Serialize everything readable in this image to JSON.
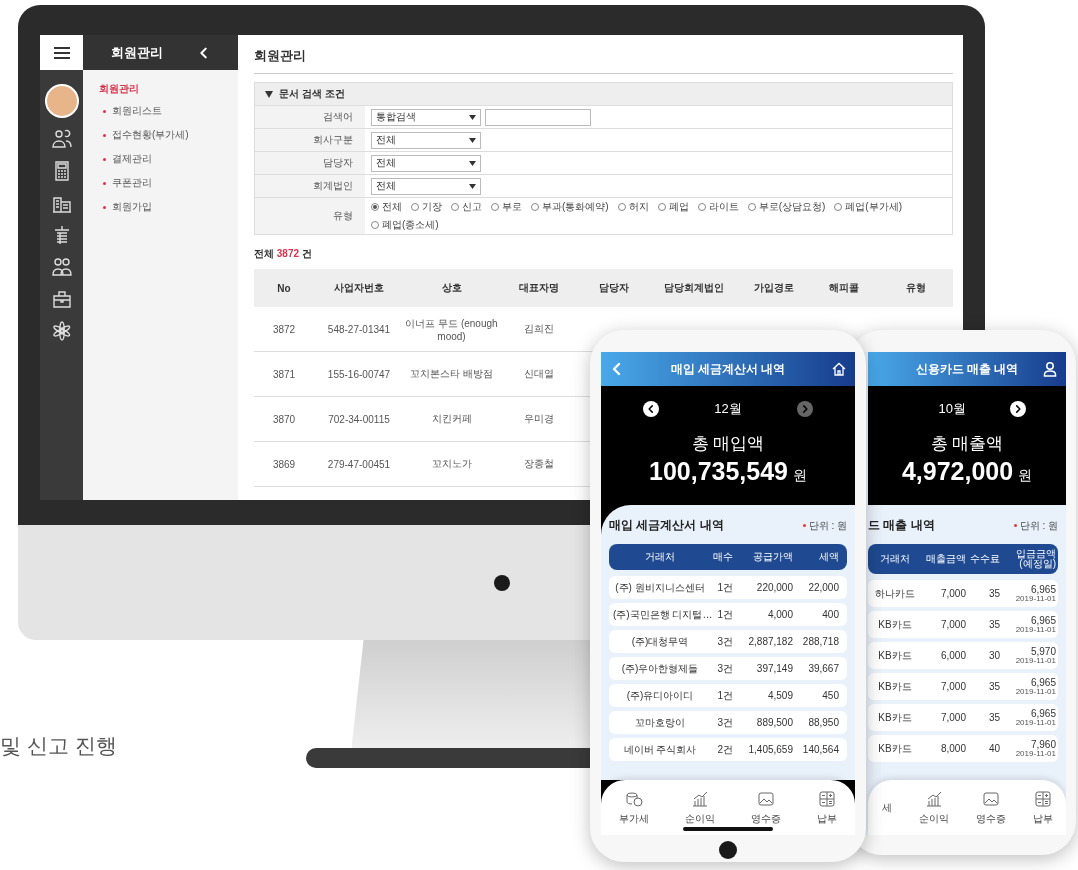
{
  "monitor": {
    "sidebar": {
      "title": "회원관리",
      "section": "회원관리",
      "items": [
        "회원리스트",
        "접수현황(부가세)",
        "결제관리",
        "쿠폰관리",
        "회원가입"
      ]
    },
    "page_title": "회원관리",
    "filter": {
      "title": "문서 검색 조건",
      "fields": [
        {
          "label": "검색어",
          "kind": "select_input",
          "value": "통합검색"
        },
        {
          "label": "회사구분",
          "kind": "select",
          "value": "전체"
        },
        {
          "label": "담당자",
          "kind": "select",
          "value": "전체"
        },
        {
          "label": "회계법인",
          "kind": "select",
          "value": "전체"
        }
      ],
      "type_label": "유형",
      "options": [
        {
          "label": "전체",
          "selected": true
        },
        {
          "label": "기장",
          "selected": false
        },
        {
          "label": "신고",
          "selected": false
        },
        {
          "label": "부로",
          "selected": false
        },
        {
          "label": "부과(통화예약)",
          "selected": false
        },
        {
          "label": "허지",
          "selected": false
        },
        {
          "label": "폐업",
          "selected": false
        },
        {
          "label": "라이트",
          "selected": false
        },
        {
          "label": "부로(상담요청)",
          "selected": false
        },
        {
          "label": "폐업(부가세)",
          "selected": false
        },
        {
          "label": "폐업(종소세)",
          "selected": false
        }
      ]
    },
    "count": {
      "prefix": "전체",
      "value": "3872",
      "suffix": "건"
    },
    "table": {
      "columns": [
        "No",
        "사업자번호",
        "상호",
        "대표자명",
        "담당자",
        "담당회계법인",
        "가입경로",
        "해피콜",
        "유형"
      ],
      "rows": [
        [
          "3872",
          "548-27-01341",
          "이너프 무드 (enough mood)",
          "김희진"
        ],
        [
          "3871",
          "155-16-00747",
          "꼬치본스타 배방점",
          "신대열"
        ],
        [
          "3870",
          "702-34-00115",
          "치킨커페",
          "우미경"
        ],
        [
          "3869",
          "279-47-00451",
          "꼬치노가",
          "장종철"
        ]
      ]
    }
  },
  "tagline": "및 신고 진행",
  "phones": [
    {
      "kind": "purchase",
      "title": "매입 세금계산서 내역",
      "month": "12월",
      "next_enabled": false,
      "total_label": "총 매입액",
      "total": "100,735,549",
      "unit": "원",
      "list_title": "매입 세금계산서 내역",
      "unit_note": "단위 : 원",
      "columns": [
        "거래처",
        "매수",
        "공급가액",
        "세액"
      ],
      "rows": [
        [
          "(주) 원비지니스센터",
          "1건",
          "220,000",
          "22,000"
        ],
        [
          "(주)국민은행 디지털…",
          "1건",
          "4,000",
          "400"
        ],
        [
          "(주)대청무역",
          "3건",
          "2,887,182",
          "288,718"
        ],
        [
          "(주)우아한형제들",
          "3건",
          "397,149",
          "39,667"
        ],
        [
          "(주)유디아이디",
          "1건",
          "4,509",
          "450"
        ],
        [
          "꼬마호랑이",
          "3건",
          "889,500",
          "88,950"
        ],
        [
          "네이버 주식회사",
          "2건",
          "1,405,659",
          "140,564"
        ]
      ],
      "nav": [
        {
          "label": "부가세",
          "kind": "vat"
        },
        {
          "label": "순이익",
          "kind": "profit"
        },
        {
          "label": "영수증",
          "kind": "receipt"
        },
        {
          "label": "납부",
          "kind": "payment"
        }
      ]
    },
    {
      "kind": "sales",
      "title": "신용카드 매출 내역",
      "month": "10월",
      "next_enabled": true,
      "total_label": "총 매출액",
      "total": "4,972,000",
      "unit": "원",
      "list_title": "드 매출 내역",
      "unit_note": "단위 : 원",
      "columns": [
        "거래처",
        "매출금액",
        "수수료",
        "입금금액 (예정일)"
      ],
      "rows": [
        [
          "하나카드",
          "7,000",
          "35",
          "6,965",
          "2019-11-01"
        ],
        [
          "KB카드",
          "7,000",
          "35",
          "6,965",
          "2019-11-01"
        ],
        [
          "KB카드",
          "6,000",
          "30",
          "5,970",
          "2019-11-01"
        ],
        [
          "KB카드",
          "7,000",
          "35",
          "6,965",
          "2019-11-01"
        ],
        [
          "KB카드",
          "7,000",
          "35",
          "6,965",
          "2019-11-01"
        ],
        [
          "KB카드",
          "8,000",
          "40",
          "7,960",
          "2019-11-01"
        ]
      ],
      "nav": [
        {
          "label": "세",
          "kind": "cut"
        },
        {
          "label": "순이익",
          "kind": "profit"
        },
        {
          "label": "영수증",
          "kind": "receipt"
        },
        {
          "label": "납부",
          "kind": "payment"
        }
      ]
    }
  ]
}
